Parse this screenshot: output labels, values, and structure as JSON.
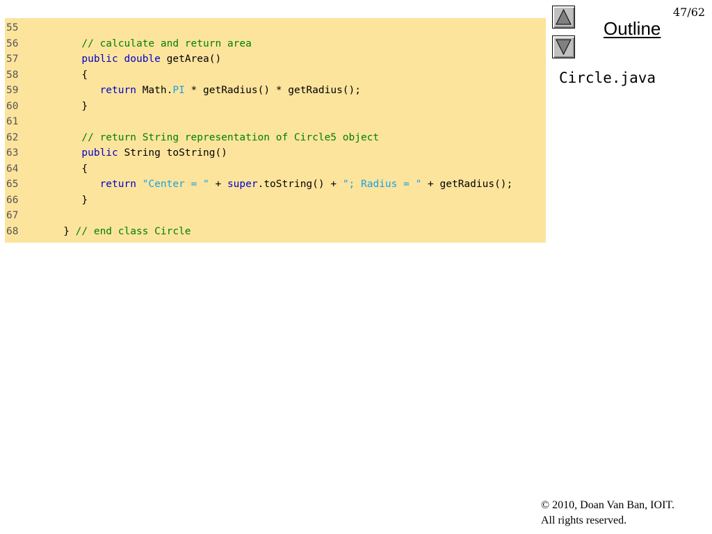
{
  "header": {
    "slide_number": "47/62",
    "outline_label": "Outline",
    "filename": "Circle.java",
    "up_icon": "triangle-up-icon",
    "down_icon": "triangle-down-icon"
  },
  "code": {
    "background": "#fde49d",
    "lines": [
      {
        "num": "55",
        "parts": []
      },
      {
        "num": "56",
        "parts": [
          {
            "t": "      ",
            "k": "plain"
          },
          {
            "t": "// calculate and return area",
            "k": "comment"
          }
        ]
      },
      {
        "num": "57",
        "parts": [
          {
            "t": "      ",
            "k": "plain"
          },
          {
            "t": "public",
            "k": "keyword"
          },
          {
            "t": " ",
            "k": "plain"
          },
          {
            "t": "double",
            "k": "keyword"
          },
          {
            "t": " getArea()",
            "k": "plain"
          }
        ]
      },
      {
        "num": "58",
        "parts": [
          {
            "t": "      {",
            "k": "plain"
          }
        ]
      },
      {
        "num": "59",
        "parts": [
          {
            "t": "         ",
            "k": "plain"
          },
          {
            "t": "return",
            "k": "keyword"
          },
          {
            "t": " Math.",
            "k": "plain"
          },
          {
            "t": "PI",
            "k": "constant"
          },
          {
            "t": " * getRadius() * getRadius();",
            "k": "plain"
          }
        ]
      },
      {
        "num": "60",
        "parts": [
          {
            "t": "      }",
            "k": "plain"
          }
        ]
      },
      {
        "num": "61",
        "parts": []
      },
      {
        "num": "62",
        "parts": [
          {
            "t": "      ",
            "k": "plain"
          },
          {
            "t": "// return String representation of Circle5 object",
            "k": "comment"
          }
        ]
      },
      {
        "num": "63",
        "parts": [
          {
            "t": "      ",
            "k": "plain"
          },
          {
            "t": "public",
            "k": "keyword"
          },
          {
            "t": " String toString()",
            "k": "plain"
          }
        ]
      },
      {
        "num": "64",
        "parts": [
          {
            "t": "      {",
            "k": "plain"
          }
        ]
      },
      {
        "num": "65",
        "parts": [
          {
            "t": "         ",
            "k": "plain"
          },
          {
            "t": "return",
            "k": "keyword"
          },
          {
            "t": " ",
            "k": "plain"
          },
          {
            "t": "\"Center = \"",
            "k": "string"
          },
          {
            "t": " + ",
            "k": "plain"
          },
          {
            "t": "super",
            "k": "keyword"
          },
          {
            "t": ".toString() + ",
            "k": "plain"
          },
          {
            "t": "\"; Radius = \"",
            "k": "string"
          },
          {
            "t": " + getRadius();",
            "k": "plain"
          }
        ]
      },
      {
        "num": "66",
        "parts": [
          {
            "t": "      }",
            "k": "plain"
          }
        ]
      },
      {
        "num": "67",
        "parts": []
      },
      {
        "num": "68",
        "parts": [
          {
            "t": "   } ",
            "k": "plain"
          },
          {
            "t": "// end class Circle",
            "k": "comment"
          }
        ]
      }
    ]
  },
  "footer": {
    "copyright_line1": "© 2010, Doan Van Ban, IOIT.",
    "copyright_line2": "All rights reserved."
  }
}
